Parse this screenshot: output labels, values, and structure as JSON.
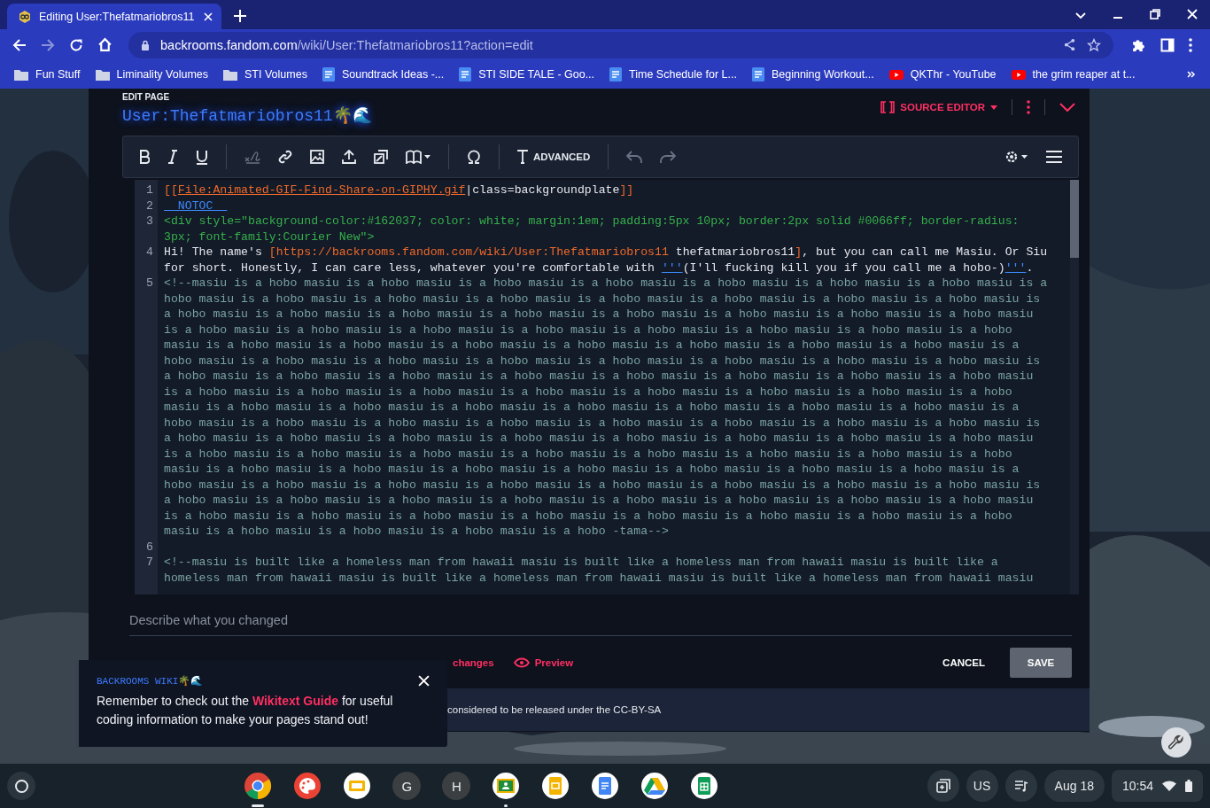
{
  "browser": {
    "tab": {
      "title": "Editing User:Thefatmariobros11",
      "selected": true
    },
    "url": {
      "host": "backrooms.fandom.com",
      "path": "/wiki/User:Thefatmariobros11?action=edit"
    },
    "bookmarks": [
      {
        "label": "Fun Stuff",
        "kind": "folder"
      },
      {
        "label": "Liminality Volumes",
        "kind": "folder"
      },
      {
        "label": "STI Volumes",
        "kind": "folder"
      },
      {
        "label": "Soundtrack Ideas -...",
        "kind": "doc"
      },
      {
        "label": "STI SIDE TALE - Goo...",
        "kind": "doc"
      },
      {
        "label": "Time Schedule for L...",
        "kind": "doc"
      },
      {
        "label": "Beginning Workout...",
        "kind": "doc"
      },
      {
        "label": "QKThr - YouTube",
        "kind": "video"
      },
      {
        "label": "the grim reaper at t...",
        "kind": "video"
      }
    ]
  },
  "editor": {
    "eyebrow": "EDIT PAGE",
    "title": "User:Thefatmariobros11🌴🌊",
    "mode_label": "SOURCE EDITOR",
    "advanced_label": "ADVANCED",
    "lines": [
      {
        "number": "1",
        "segments": [
          {
            "text": "[[",
            "kind": "bracket"
          },
          {
            "text": "File:Animated-GIF-Find-Share-on-GIPHY.gif",
            "kind": "target"
          },
          {
            "text": "|class=backgroundplate",
            "kind": "plain"
          },
          {
            "text": "]]",
            "kind": "bracket"
          }
        ]
      },
      {
        "number": "2",
        "segments": [
          {
            "text": "__NOTOC__",
            "kind": "magic"
          }
        ]
      },
      {
        "number": "3",
        "segments": [
          {
            "text": "<div style=\"background-color:#162037; color: white; margin:1em; padding:5px 10px; border:2px solid #0066ff; border-radius: 3px; font-family:Courier New\">",
            "kind": "tag"
          }
        ]
      },
      {
        "number": "4",
        "segments": [
          {
            "text": "Hi! The name's ",
            "kind": "plain"
          },
          {
            "text": "[https://backrooms.fandom.com/wiki/User:Thefatmariobros11",
            "kind": "bracket"
          },
          {
            "text": " thefatmariobros11",
            "kind": "plain"
          },
          {
            "text": "]",
            "kind": "bracket"
          },
          {
            "text": ", but you can call me Masiu. Or Siu for short. Honestly, I can care less, whatever you're comfortable with ",
            "kind": "plain"
          },
          {
            "text": "'''",
            "kind": "magic"
          },
          {
            "text": "(I'll fucking kill you if you call me a hobo-)",
            "kind": "plain"
          },
          {
            "text": "'''",
            "kind": "magic"
          },
          {
            "text": ".",
            "kind": "plain"
          }
        ]
      },
      {
        "number": "5",
        "segments": [
          {
            "text": "<!--masiu is a hobo masiu is a hobo masiu is a hobo masiu is a hobo masiu is a hobo masiu is a hobo masiu is a hobo masiu is a hobo masiu is a hobo masiu is a hobo masiu is a hobo masiu is a hobo masiu is a hobo masiu is a hobo masiu is a hobo masiu is a hobo masiu is a hobo masiu is a hobo masiu is a hobo masiu is a hobo masiu is a hobo masiu is a hobo masiu is a hobo masiu is a hobo masiu is a hobo masiu is a hobo masiu is a hobo masiu is a hobo masiu is a hobo masiu is a hobo masiu is a hobo masiu is a hobo masiu is a hobo masiu is a hobo masiu is a hobo masiu is a hobo masiu is a hobo masiu is a hobo masiu is a hobo masiu is a hobo masiu is a hobo masiu is a hobo masiu is a hobo masiu is a hobo masiu is a hobo masiu is a hobo masiu is a hobo masiu is a hobo masiu is a hobo masiu is a hobo masiu is a hobo masiu is a hobo masiu is a hobo masiu is a hobo masiu is a hobo masiu is a hobo masiu is a hobo masiu is a hobo masiu is a hobo masiu is a hobo masiu is a hobo masiu is a hobo masiu is a hobo masiu is a hobo masiu is a hobo masiu is a hobo masiu is a hobo masiu is a hobo masiu is a hobo masiu is a hobo masiu is a hobo masiu is a hobo masiu is a hobo masiu is a hobo masiu is a hobo masiu is a hobo masiu is a hobo masiu is a hobo masiu is a hobo masiu is a hobo masiu is a hobo masiu is a hobo masiu is a hobo masiu is a hobo masiu is a hobo masiu is a hobo masiu is a hobo masiu is a hobo masiu is a hobo masiu is a hobo masiu is a hobo masiu is a hobo masiu is a hobo masiu is a hobo masiu is a hobo masiu is a hobo masiu is a hobo masiu is a hobo masiu is a hobo masiu is a hobo masiu is a hobo masiu is a hobo masiu is a hobo masiu is a hobo masiu is a hobo masiu is a hobo masiu is a hobo masiu is a hobo masiu is a hobo masiu is a hobo masiu is a hobo masiu is a hobo masiu is a hobo masiu is a hobo masiu is a hobo masiu is a hobo masiu is a hobo masiu is a hobo masiu is a hobo masiu is a hobo masiu is a hobo masiu is a hobo masiu is a hobo masiu is a hobo masiu is a hobo masiu is a hobo masiu is a hobo masiu is a hobo -tama-->",
            "kind": "comment"
          }
        ]
      },
      {
        "number": "6"
      },
      {
        "number": "7",
        "segments": [
          {
            "text": "<!--masiu is built like a homeless man from hawaii masiu is built like a homeless man from hawaii masiu is built like a homeless man from hawaii masiu is built like a homeless man from hawaii masiu is built like a homeless man from hawaii masiu",
            "kind": "comment"
          }
        ]
      }
    ],
    "summary_placeholder": "Describe what you changed",
    "links": [
      {
        "label": "changes",
        "kind": "changes"
      },
      {
        "label": "Preview",
        "kind": "preview"
      }
    ],
    "cancel": "CANCEL",
    "save": "SAVE",
    "license_text": "considered to be released under the CC-BY-SA"
  },
  "toast": {
    "site": "BACKROOMS WIKI🌴🌊",
    "before": "Remember to check out the ",
    "link": "Wikitext Guide",
    "after": " for useful coding information to make your pages stand out!"
  },
  "taskbar": {
    "apps": [
      {
        "kind": "chrome",
        "open": true
      },
      {
        "kind": "paint",
        "open": false
      },
      {
        "kind": "slides-wide",
        "open": false
      },
      {
        "kind": "letter",
        "letter": "G",
        "open": false
      },
      {
        "kind": "letter",
        "letter": "H",
        "open": false
      },
      {
        "kind": "classroom",
        "open": true
      },
      {
        "kind": "slides",
        "open": false
      },
      {
        "kind": "docs",
        "open": false
      },
      {
        "kind": "drive",
        "open": false
      },
      {
        "kind": "sheets",
        "open": false
      }
    ],
    "keyboard": "US",
    "date": "Aug 18",
    "time": "10:54"
  }
}
